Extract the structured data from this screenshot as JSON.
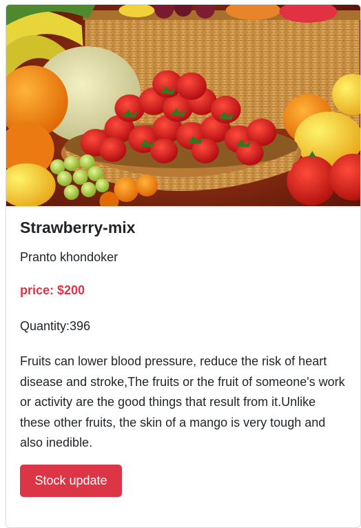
{
  "product": {
    "title": "Strawberry-mix",
    "supplier": "Pranto khondoker",
    "price": "price: $200",
    "quantity": "Quantity:396",
    "description": "Fruits can lower blood pressure, reduce the risk of heart disease and stroke,The fruits or the fruit of someone's work or activity are the good things that result from it.Unlike these other fruits, the skin of a mango is very tough and also inedible.",
    "image_alt": "fruit basket with strawberries"
  },
  "actions": {
    "stock_update_label": "Stock update"
  },
  "colors": {
    "accent": "#dc3545",
    "text": "#212529"
  }
}
